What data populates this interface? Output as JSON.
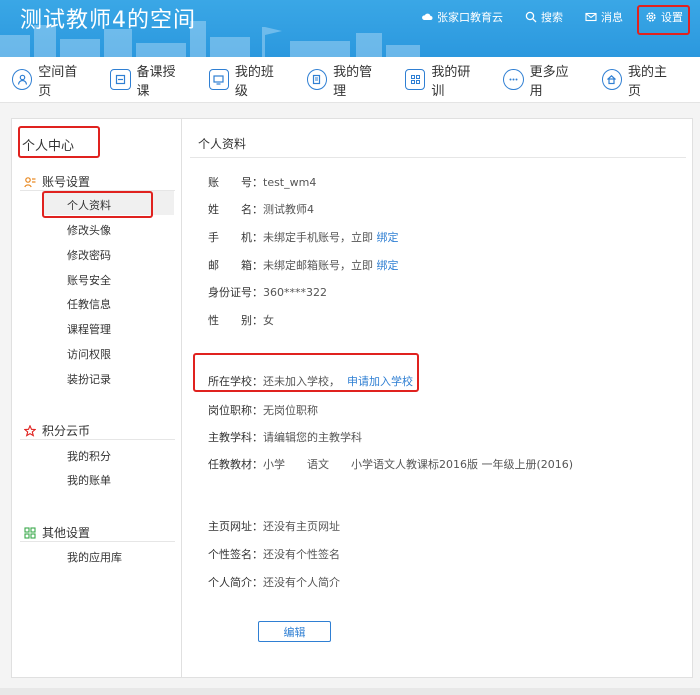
{
  "header": {
    "site_title": "测试教师4的空间",
    "links": [
      {
        "label": "张家口教育云",
        "icon": "cloud-icon"
      },
      {
        "label": "搜索",
        "icon": "search-icon"
      },
      {
        "label": "消息",
        "icon": "mail-icon"
      },
      {
        "label": "设置",
        "icon": "gear-icon"
      }
    ]
  },
  "nav": {
    "items": [
      {
        "label": "空间首页",
        "icon": "user-icon"
      },
      {
        "label": "备课授课",
        "icon": "lesson-icon"
      },
      {
        "label": "我的班级",
        "icon": "monitor-icon"
      },
      {
        "label": "我的管理",
        "icon": "document-icon"
      },
      {
        "label": "我的研训",
        "icon": "grid-icon"
      },
      {
        "label": "更多应用",
        "icon": "more-icon"
      },
      {
        "label": "我的主页",
        "icon": "home-icon"
      }
    ]
  },
  "sidebar": {
    "title": "个人中心",
    "groups": [
      {
        "title": "账号设置",
        "icon": "account-icon",
        "items": [
          "个人资料",
          "修改头像",
          "修改密码",
          "账号安全",
          "任教信息",
          "课程管理",
          "访问权限",
          "装扮记录"
        ]
      },
      {
        "title": "积分云币",
        "icon": "star-icon",
        "items": [
          "我的积分",
          "我的账单"
        ]
      },
      {
        "title": "其他设置",
        "icon": "apps-icon",
        "items": [
          "我的应用库"
        ]
      }
    ]
  },
  "main": {
    "title": "个人资料",
    "account": {
      "label": "账　　号：",
      "value": "test_wm4"
    },
    "name": {
      "label": "姓　　名：",
      "value": "测试教师4"
    },
    "phone": {
      "label": "手　　机：",
      "value": "未绑定手机账号，立即 ",
      "link": "绑定"
    },
    "email": {
      "label": "邮　　箱：",
      "value": "未绑定邮箱账号，立即 ",
      "link": "绑定"
    },
    "id_card": {
      "label": "身份证号：",
      "value": "360****322"
    },
    "gender": {
      "label": "性　　别：",
      "value": "女"
    },
    "school": {
      "label": "所在学校：",
      "value": "还未加入学校，",
      "link": "申请加入学校"
    },
    "position": {
      "label": "岗位职称：",
      "value": "无岗位职称"
    },
    "subject": {
      "label": "主教学科：",
      "value": "请编辑您的主教学科"
    },
    "textbook": {
      "label": "任教教材：",
      "value": "小学　　语文　　小学语文人教课标2016版 一年级上册(2016)"
    },
    "homepage": {
      "label": "主页网址：",
      "value": "还没有主页网址"
    },
    "signature": {
      "label": "个性签名：",
      "value": "还没有个性签名"
    },
    "bio": {
      "label": "个人简介：",
      "value": "还没有个人简介"
    },
    "edit_button": "编辑"
  },
  "colors": {
    "header_blue": "#2b98de",
    "link_blue": "#2f7fd3",
    "highlight_red": "#e0221f"
  }
}
